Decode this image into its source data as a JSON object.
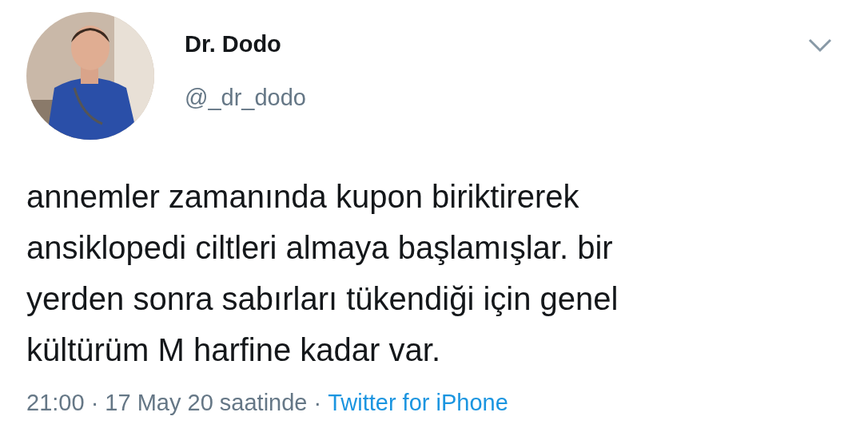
{
  "author": {
    "name": "Dr. Dodo",
    "handle": "@_dr_dodo"
  },
  "tweet": {
    "text": "annemler zamanında kupon biriktirerek\nansiklopedi ciltleri almaya başlamışlar. bir\nyerden sonra sabırları tükendiği için genel\nkültürüm M harfine kadar var."
  },
  "footer": {
    "timestamp": "21:00 · 17 May 20 saatinde",
    "separator": "·",
    "source": "Twitter for iPhone"
  }
}
